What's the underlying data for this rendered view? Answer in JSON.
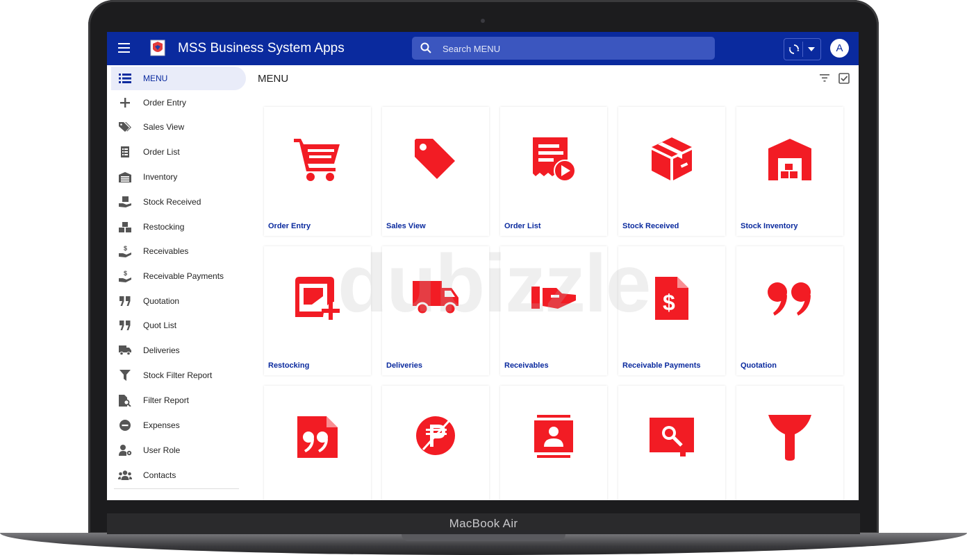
{
  "device": {
    "label": "MacBook Air"
  },
  "appbar": {
    "title": "MSS Business System Apps",
    "search_placeholder": "Search MENU",
    "avatar_initial": "A",
    "color": "#0a2a9e"
  },
  "sidebar": {
    "items": [
      {
        "label": "MENU",
        "icon": "list-icon"
      },
      {
        "label": "Order Entry",
        "icon": "plus-icon"
      },
      {
        "label": "Sales View",
        "icon": "tags-icon"
      },
      {
        "label": "Order List",
        "icon": "list-doc-icon"
      },
      {
        "label": "Inventory",
        "icon": "warehouse-icon"
      },
      {
        "label": "Stock Received",
        "icon": "box-hand-icon"
      },
      {
        "label": "Restocking",
        "icon": "boxes-icon"
      },
      {
        "label": "Receivables",
        "icon": "dollar-hand-icon"
      },
      {
        "label": "Receivable Payments",
        "icon": "dollar-hand-icon"
      },
      {
        "label": "Quotation",
        "icon": "quote-icon"
      },
      {
        "label": "Quot List",
        "icon": "quote-icon"
      },
      {
        "label": "Deliveries",
        "icon": "truck-icon"
      },
      {
        "label": "Stock Filter Report",
        "icon": "filter-icon"
      },
      {
        "label": "Filter Report",
        "icon": "file-search-icon"
      },
      {
        "label": "Expenses",
        "icon": "minus-circle-icon"
      },
      {
        "label": "User Role",
        "icon": "user-gear-icon"
      },
      {
        "label": "Contacts",
        "icon": "users-icon"
      }
    ]
  },
  "main": {
    "title": "MENU",
    "tiles": [
      {
        "label": "Order Entry",
        "icon": "cart-icon"
      },
      {
        "label": "Sales View",
        "icon": "tag-icon"
      },
      {
        "label": "Order List",
        "icon": "receipt-play-icon"
      },
      {
        "label": "Stock Received",
        "icon": "box-icon"
      },
      {
        "label": "Stock Inventory",
        "icon": "warehouse-icon"
      },
      {
        "label": "Restocking",
        "icon": "folder-plus-icon"
      },
      {
        "label": "Deliveries",
        "icon": "truck-icon"
      },
      {
        "label": "Receivables",
        "icon": "hand-icon"
      },
      {
        "label": "Receivable Payments",
        "icon": "file-dollar-icon"
      },
      {
        "label": "Quotation",
        "icon": "quote-icon"
      },
      {
        "label": "",
        "icon": "file-quote-icon"
      },
      {
        "label": "",
        "icon": "peso-off-icon"
      },
      {
        "label": "",
        "icon": "contact-icon"
      },
      {
        "label": "",
        "icon": "image-search-icon"
      },
      {
        "label": "",
        "icon": "funnel-icon"
      }
    ]
  },
  "watermark": "dubizzle",
  "accent_color": "#f21c24"
}
